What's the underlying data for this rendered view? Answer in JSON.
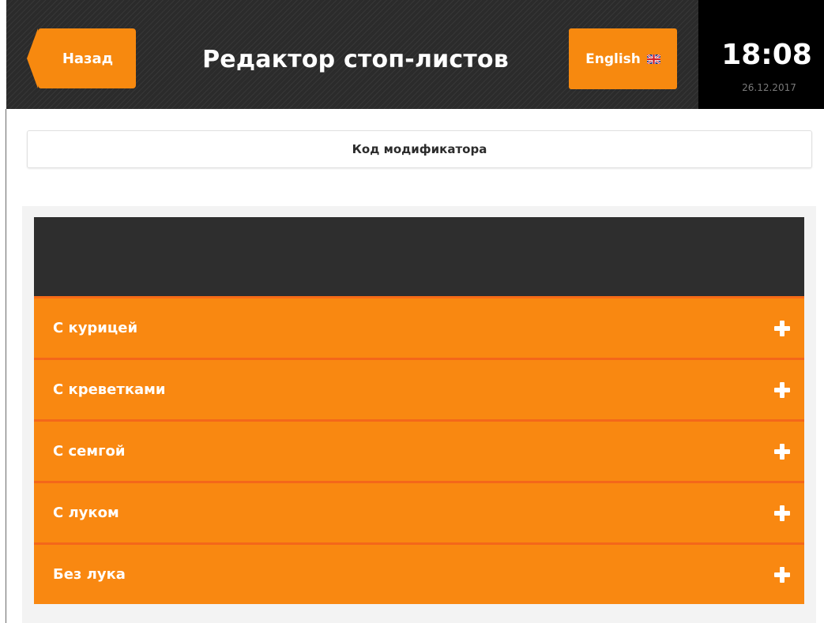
{
  "header": {
    "back_label": "Назад",
    "title": "Редактор стоп-листов",
    "language_label": "English",
    "language_flag_icon": "uk-flag-icon",
    "time": "18:08",
    "date": "26.12.2017"
  },
  "search": {
    "placeholder": "Код модификатора"
  },
  "modifiers": [
    {
      "label": "С курицей"
    },
    {
      "label": "С креветками"
    },
    {
      "label": "С семгой"
    },
    {
      "label": "С луком"
    },
    {
      "label": "Без лука"
    }
  ],
  "colors": {
    "accent": "#f7890f",
    "header_bg": "#2b2b2b",
    "row_separator": "#f4671a",
    "panel_dark": "#2e2e2e"
  }
}
